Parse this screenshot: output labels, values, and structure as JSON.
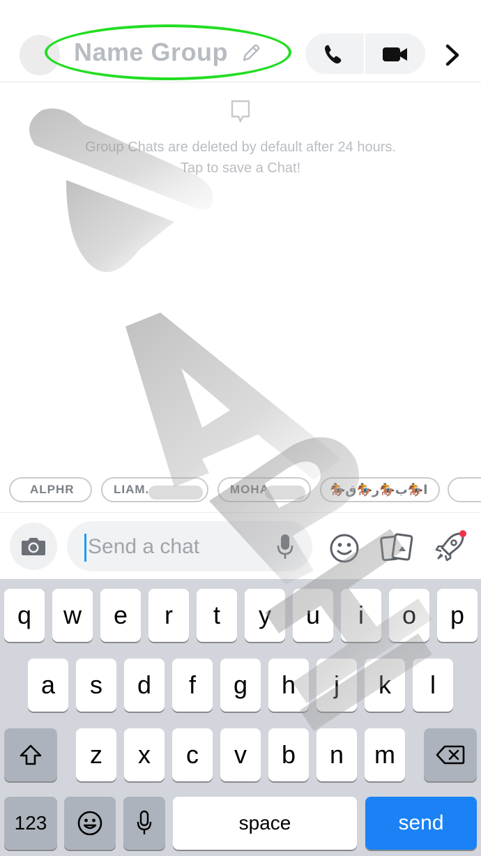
{
  "header": {
    "title": "Name Group",
    "title_highlight_color": "#22dd22",
    "icons": [
      "pencil-icon",
      "phone-icon",
      "video-icon",
      "chevron-right-icon"
    ]
  },
  "chat": {
    "notice_line1": "Group Chats are deleted by default after 24 hours.",
    "notice_line2": "Tap to save a Chat!"
  },
  "chips": [
    {
      "label": "ALPHR"
    },
    {
      "label": "LIAM."
    },
    {
      "label": "MOHA"
    },
    {
      "label": "🏇ﺍ🏇ﺏ🏇ﺭ🏇ﻕ"
    },
    {
      "label": ""
    }
  ],
  "input": {
    "placeholder": "Send a chat",
    "caret_color": "#1e9bf0",
    "icons": [
      "camera-icon",
      "microphone-icon",
      "smile-icon",
      "cards-icon",
      "rocket-icon"
    ],
    "notification_dot_color": "#f0324a"
  },
  "keyboard": {
    "row1": [
      "q",
      "w",
      "e",
      "r",
      "t",
      "y",
      "u",
      "i",
      "o",
      "p"
    ],
    "row2": [
      "a",
      "s",
      "d",
      "f",
      "g",
      "h",
      "j",
      "k",
      "l"
    ],
    "row3": [
      "z",
      "x",
      "c",
      "v",
      "b",
      "n",
      "m"
    ],
    "numbers_label": "123",
    "space_label": "space",
    "send_label": "send",
    "send_color": "#1a82f5"
  }
}
